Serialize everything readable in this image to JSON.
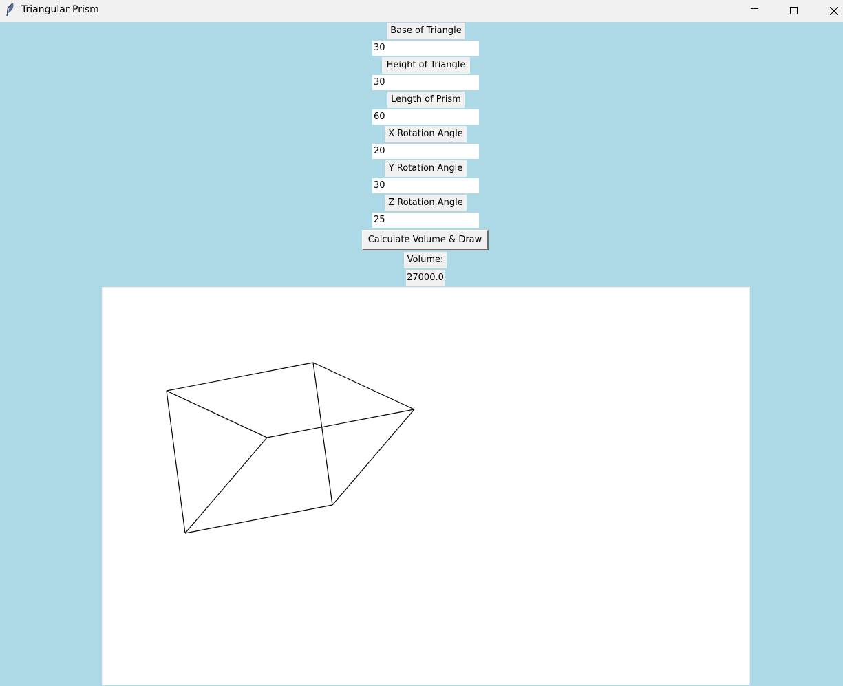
{
  "window": {
    "title": "Triangular Prism",
    "icon": "feather-icon",
    "controls": [
      "minimize-icon",
      "maximize-icon",
      "close-icon"
    ]
  },
  "form": {
    "base_label": "Base of Triangle",
    "base_value": "30",
    "height_label": "Height of Triangle",
    "height_value": "30",
    "length_label": "Length of Prism",
    "length_value": "60",
    "x_rot_label": "X Rotation Angle",
    "x_rot_value": "20",
    "y_rot_label": "Y Rotation Angle",
    "y_rot_value": "30",
    "z_rot_label": "Z Rotation Angle",
    "z_rot_value": "25",
    "button_label": "Calculate Volume & Draw",
    "volume_label": "Volume:",
    "volume_value": "27000.0"
  },
  "colors": {
    "background": "#add8e6",
    "widget_bg": "#f0f0f0",
    "canvas_bg": "#ffffff",
    "line": "#000000"
  }
}
